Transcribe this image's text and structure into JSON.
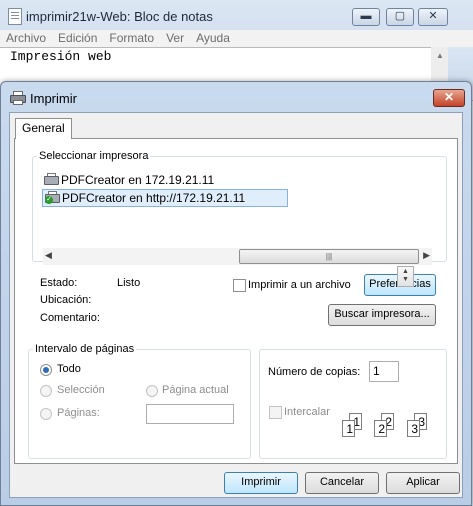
{
  "notepad": {
    "title": "imprimir21w-Web: Bloc de notas",
    "menu": [
      "Archivo",
      "Edición",
      "Formato",
      "Ver",
      "Ayuda"
    ],
    "content": "Impresión web",
    "controls": {
      "minimize": "▬",
      "maximize": "▢",
      "close": "✕"
    }
  },
  "dialog": {
    "title": "Imprimir",
    "close_glyph": "✕",
    "tab_general": "General",
    "select_printer": {
      "label": "Seleccionar impresora",
      "printers": [
        {
          "name": "PDFCreator en 172.19.21.11",
          "selected": false
        },
        {
          "name": "PDFCreator en http://172.19.21.11",
          "selected": true
        }
      ],
      "scroll_grip": "|||"
    },
    "status": {
      "estado_label": "Estado:",
      "estado_value": "Listo",
      "ubicacion_label": "Ubicación:",
      "ubicacion_value": "",
      "comentario_label": "Comentario:",
      "comentario_value": ""
    },
    "print_to_file": {
      "label": "Imprimir a un archivo",
      "checked": false
    },
    "preferences_button": "Preferencias",
    "find_printer_button": "Buscar impresora...",
    "page_range": {
      "label": "Intervalo de páginas",
      "options": [
        {
          "label": "Todo",
          "checked": true,
          "enabled": true
        },
        {
          "label": "Selección",
          "checked": false,
          "enabled": false
        },
        {
          "label": "Página actual",
          "checked": false,
          "enabled": false
        },
        {
          "label": "Páginas:",
          "checked": false,
          "enabled": false
        }
      ],
      "pages_value": ""
    },
    "copies": {
      "label": "Número de copias:",
      "value": "1"
    },
    "collate": {
      "label": "Intercalar",
      "checked": false,
      "enabled": false,
      "pages": [
        "1",
        "1",
        "2",
        "2",
        "3",
        "3"
      ]
    },
    "buttons": {
      "print": "Imprimir",
      "cancel": "Cancelar",
      "apply": "Aplicar"
    }
  }
}
